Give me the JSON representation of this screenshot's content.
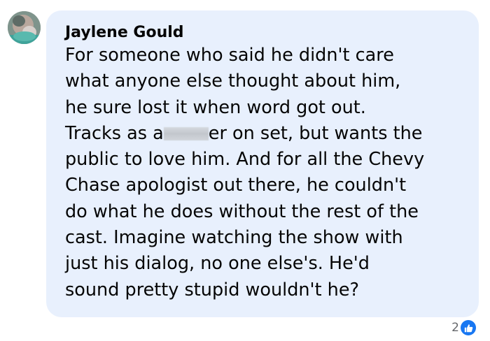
{
  "comment": {
    "author": "Jaylene Gould",
    "lines": [
      "For someone who said he didn't care",
      "what anyone else thought about him,",
      "he sure lost it when word got out.",
      {
        "before": "Tracks as a",
        "after": "er on set, but wants the"
      },
      "public to love him. And for all the Chevy",
      "Chase apologist out there, he couldn't",
      "do what he does without the rest of the",
      "cast. Imagine watching the show with",
      "just his dialog, no one else's. He'd",
      "sound pretty stupid wouldn't he?"
    ]
  },
  "reactions": {
    "count": "2",
    "icon": "thumbs-up-icon",
    "color": "#1877f2"
  },
  "bubble_color": "#e8f0fd"
}
